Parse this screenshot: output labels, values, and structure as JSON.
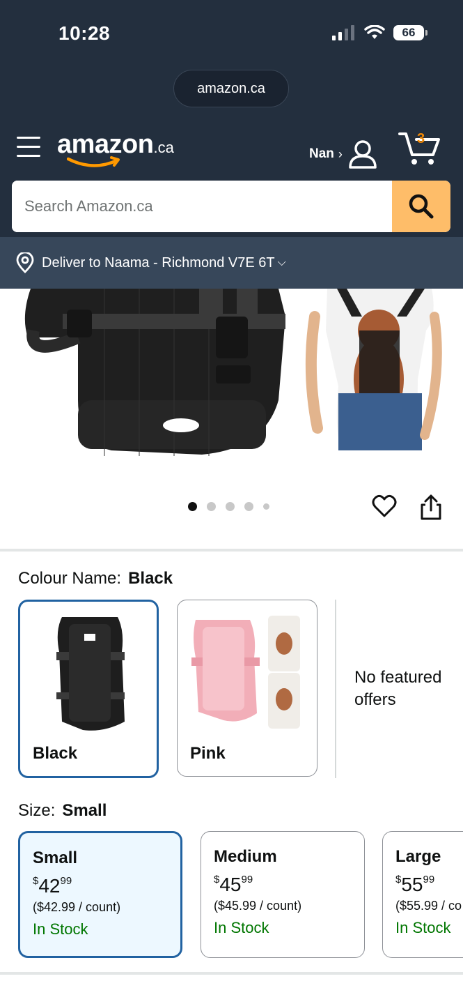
{
  "status": {
    "time": "10:28",
    "battery": "66"
  },
  "browser": {
    "url": "amazon.ca"
  },
  "header": {
    "logo_word": "amazon",
    "logo_tld": ".ca",
    "account_name": "Nan",
    "account_chevron": "›",
    "cart_count": "3"
  },
  "search": {
    "placeholder": "Search Amazon.ca"
  },
  "deliver": {
    "text": "Deliver to Naama - Richmond V7E 6T",
    "chevron": "⌵"
  },
  "gallery": {
    "image_count": 5,
    "active_index": 0
  },
  "colour": {
    "label": "Colour Name:",
    "selected": "Black",
    "options": [
      {
        "label": "Black"
      },
      {
        "label": "Pink"
      }
    ],
    "no_offers_text": "No featured offers"
  },
  "size": {
    "label": "Size:",
    "selected": "Small",
    "options": [
      {
        "name": "Small",
        "currency": "$",
        "whole": "42",
        "fraction": "99",
        "unit": "($42.99 / count)",
        "stock": "In Stock"
      },
      {
        "name": "Medium",
        "currency": "$",
        "whole": "45",
        "fraction": "99",
        "unit": "($45.99 / count)",
        "stock": "In Stock"
      },
      {
        "name": "Large",
        "currency": "$",
        "whole": "55",
        "fraction": "99",
        "unit": "($55.99 / co",
        "stock": "In Stock"
      }
    ]
  },
  "colors": {
    "header_bg": "#232f3e",
    "deliver_bg": "#37475a",
    "search_button": "#febd69",
    "selected_border": "#2162a1",
    "in_stock": "#007600",
    "cart_count": "#f08804"
  },
  "icons": {
    "menu": "hamburger-menu-icon",
    "account": "person-icon",
    "cart": "cart-icon",
    "search": "magnifier-icon",
    "location": "location-pin-icon",
    "wishlist": "heart-icon",
    "share": "share-icon"
  }
}
